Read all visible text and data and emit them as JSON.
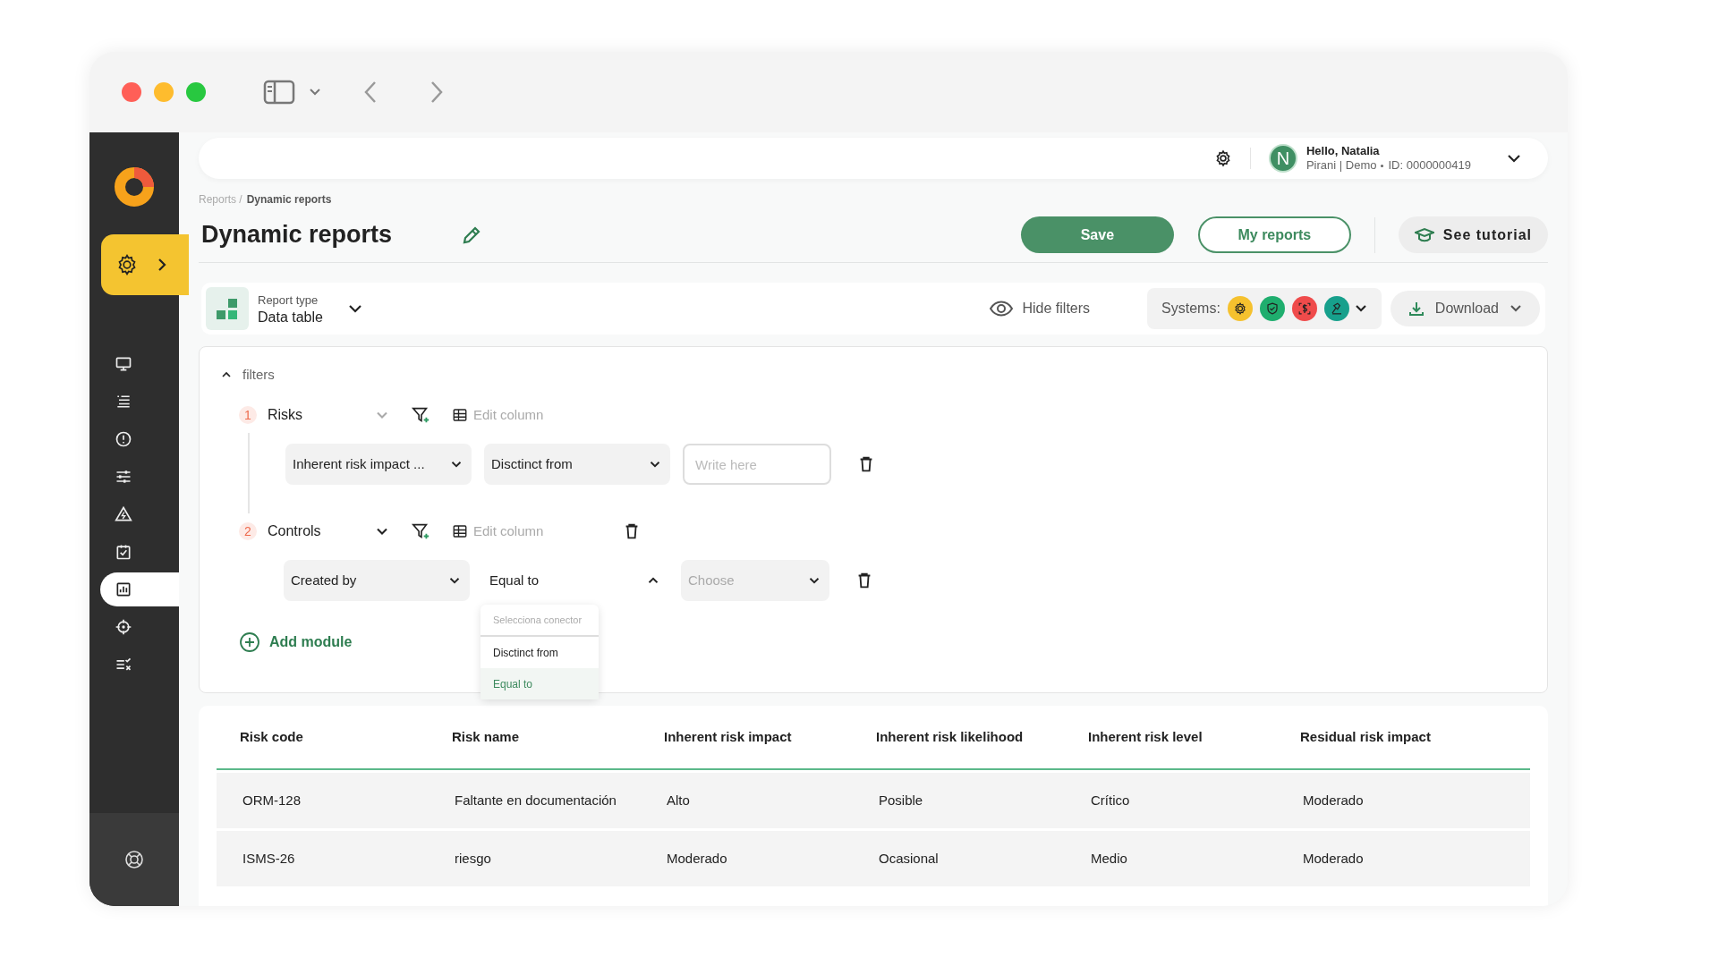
{
  "sidebar": {
    "items": [
      {
        "kind": "monitor",
        "selected": false
      },
      {
        "kind": "list",
        "selected": false
      },
      {
        "kind": "alert",
        "selected": false
      },
      {
        "kind": "sliders",
        "selected": false
      },
      {
        "kind": "warning",
        "selected": false
      },
      {
        "kind": "checklist",
        "selected": false
      },
      {
        "kind": "chart",
        "selected": true
      },
      {
        "kind": "target",
        "selected": false
      },
      {
        "kind": "tasks",
        "selected": false
      }
    ]
  },
  "header": {
    "greeting": "Hello, Natalia",
    "avatar": "N",
    "organization": "Pirani | Demo",
    "id": "ID: 0000000419"
  },
  "breadcrumb": [
    "Reports /",
    "Dynamic reports"
  ],
  "page_title": "Dynamic reports",
  "buttons": {
    "save": "Save",
    "my_reports": "My reports",
    "tutorial": "See tutorial"
  },
  "report_type": {
    "label": "Report type",
    "value": "Data table"
  },
  "hide_filters": "Hide filters",
  "systems": {
    "label": "Systems:",
    "items": [
      {
        "kind": "gear",
        "color": "#f5c12e"
      },
      {
        "kind": "shield",
        "color": "#1fae6e"
      },
      {
        "kind": "dollar",
        "color": "#ef4b4b"
      },
      {
        "kind": "hammer",
        "color": "#17a08c"
      }
    ]
  },
  "download": "Download",
  "filters": {
    "title": "filters",
    "expanded": true,
    "modules": [
      {
        "number": "1",
        "name": "Risks",
        "disabled": true,
        "edit_column": "Edit column",
        "deletable": false,
        "conditions": [
          {
            "field": "Inherent risk impact ...",
            "operator": "Disctinct from",
            "operator_open": false,
            "kind": "text",
            "placeholder": "Write here"
          }
        ]
      },
      {
        "number": "2",
        "name": "Controls",
        "disabled": false,
        "edit_column": "Edit column",
        "deletable": true,
        "conditions": [
          {
            "field": "Created by",
            "operator": "Equal to",
            "operator_open": true,
            "kind": "select",
            "placeholder": "Choose"
          }
        ]
      }
    ],
    "menu": {
      "header": "Selecciona conector",
      "options": [
        {
          "label": "Disctinct from",
          "selected": false
        },
        {
          "label": "Equal to",
          "selected": true
        }
      ]
    },
    "add_module": "Add module"
  },
  "table": {
    "columns": [
      "Risk code",
      "Risk name",
      "Inherent risk impact",
      "Inherent risk likelihood",
      "Inherent risk level",
      "Residual risk impact"
    ],
    "rows": [
      [
        "ORM-128",
        "Faltante en documentación",
        "Alto",
        "Posible",
        "Crítico",
        "Moderado"
      ],
      [
        "ISMS-26",
        "riesgo",
        "Moderado",
        "Ocasional",
        "Medio",
        "Moderado"
      ]
    ]
  }
}
